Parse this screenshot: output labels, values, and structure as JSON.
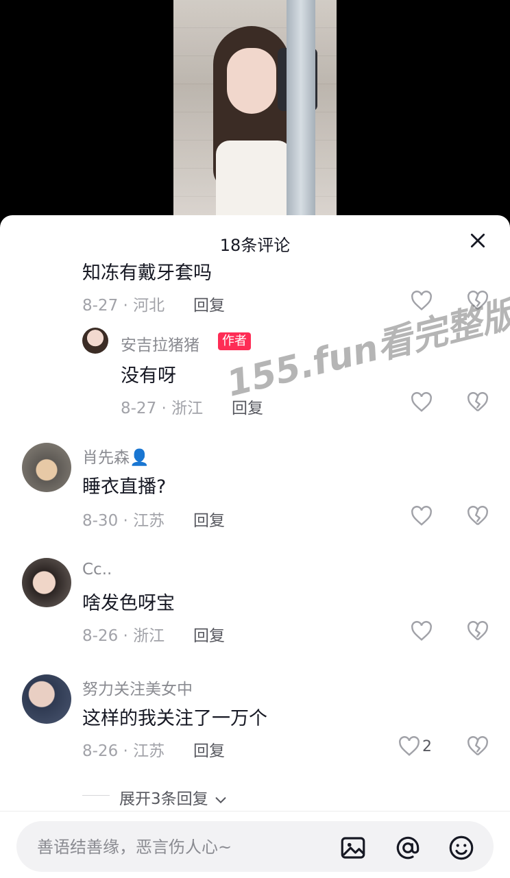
{
  "sheet": {
    "title": "18条评论"
  },
  "comments": [
    {
      "truncated_text": "知冻有戴牙套吗",
      "date_region": "8-27 · 河北",
      "reply_label": "回复"
    },
    {
      "nickname": "安吉拉猪猪",
      "badge": "作者",
      "text": "没有呀",
      "date_region": "8-27 · 浙江",
      "reply_label": "回复"
    },
    {
      "nickname": "肖先森👤",
      "text": "睡衣直播?",
      "date_region": "8-30 · 江苏",
      "reply_label": "回复"
    },
    {
      "nickname": "Cc..",
      "text": "啥发色呀宝",
      "date_region": "8-26 · 浙江",
      "reply_label": "回复"
    },
    {
      "nickname": "努力关注美女中",
      "text": "这样的我关注了一万个",
      "date_region": "8-26 · 江苏",
      "reply_label": "回复",
      "like_count": "2"
    }
  ],
  "expand_replies": "展开3条回复",
  "watermark": "155.fun看完整版",
  "input": {
    "placeholder": "善语结善缘，恶言伤人心~"
  },
  "icons": {
    "close": "close-icon",
    "like": "heart-icon",
    "dislike": "broken-heart-icon",
    "image": "image-icon",
    "mention": "at-icon",
    "emoji": "emoji-icon",
    "chevron": "chevron-down-icon"
  },
  "colors": {
    "badge": "#fe2c55",
    "text": "#161823",
    "secondary": "#8a8b91"
  }
}
